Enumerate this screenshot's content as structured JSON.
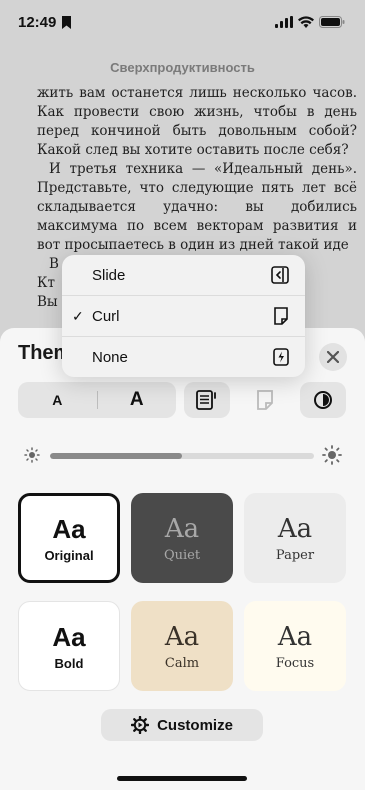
{
  "status": {
    "time": "12:49"
  },
  "book": {
    "title": "Сверхпродуктивность",
    "paragraphs": [
      "жить вам останется лишь несколько часов. Как провести свою жизнь, чтобы в день перед кончиной быть довольным собой? Какой след вы хотите оставить после себя?",
      "И третья техника — «Идеальный день». Представьте, что следующие пять лет всё складывается удачно: вы добились максимума по всем векторам развития и вот просыпаетесь в один из дней такой иде"
    ],
    "fragments": [
      "В",
      "Кт",
      "Вы"
    ]
  },
  "popup": {
    "items": [
      {
        "label": "Slide",
        "checked": false,
        "icon": "slide-icon"
      },
      {
        "label": "Curl",
        "checked": true,
        "icon": "curl-icon"
      },
      {
        "label": "None",
        "checked": false,
        "icon": "none-transition-icon"
      }
    ],
    "check_mark": "✓"
  },
  "sheet": {
    "title": "Them",
    "size_small": "A",
    "size_large": "A",
    "brightness": 0.5,
    "themes": [
      {
        "aa": "Aa",
        "name": "Original",
        "bg": "#ffffff",
        "fg": "#111111",
        "style": "sans",
        "selected": true
      },
      {
        "aa": "Aa",
        "name": "Quiet",
        "bg": "#4a4a4a",
        "fg": "#a8a8a8",
        "style": "serif",
        "selected": false
      },
      {
        "aa": "Aa",
        "name": "Paper",
        "bg": "#ececec",
        "fg": "#333333",
        "style": "serif",
        "selected": false
      },
      {
        "aa": "Aa",
        "name": "Bold",
        "bg": "#ffffff",
        "fg": "#111111",
        "style": "sans",
        "selected": false
      },
      {
        "aa": "Aa",
        "name": "Calm",
        "bg": "#efe0c6",
        "fg": "#3a3228",
        "style": "serif",
        "selected": false
      },
      {
        "aa": "Aa",
        "name": "Focus",
        "bg": "#fffbef",
        "fg": "#333333",
        "style": "serif",
        "selected": false
      }
    ],
    "customize_label": "Customize"
  }
}
